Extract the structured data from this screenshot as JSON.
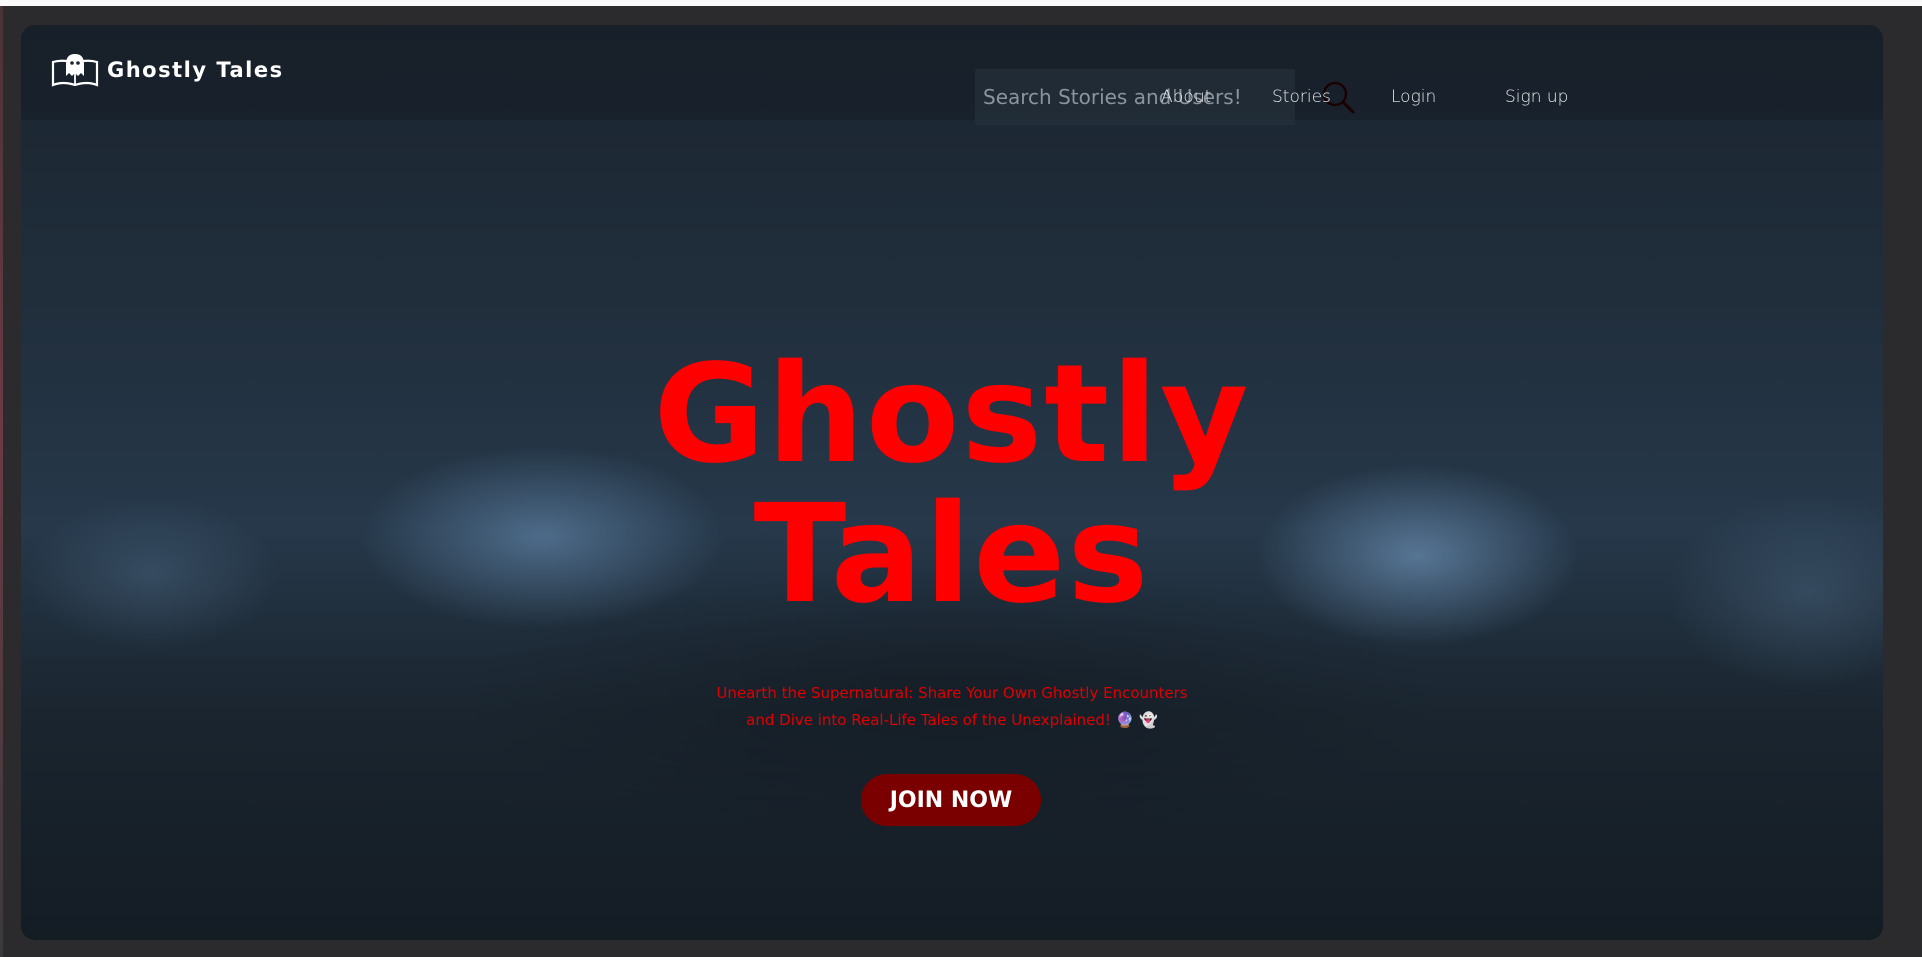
{
  "brand": {
    "name": "Ghostly Tales",
    "icon": "ghost-book-icon"
  },
  "search": {
    "placeholder": "Search Stories and Users!",
    "value": "",
    "icon": "search-icon"
  },
  "nav": {
    "about": "About",
    "stories": "Stories",
    "login": "Login",
    "signup": "Sign up"
  },
  "hero": {
    "title_line1": "Ghostly",
    "title_line2": "Tales",
    "subtitle_line1": "Unearth the Supernatural: Share Your Own Ghostly Encounters",
    "subtitle_line2": "and Dive into Real-Life Tales of the Unexplained! 🔮 👻",
    "cta_label": "JOIN NOW"
  },
  "colors": {
    "accent": "#ff0000",
    "cta_background": "#7a0000",
    "nav_text": "#e8eaec"
  }
}
